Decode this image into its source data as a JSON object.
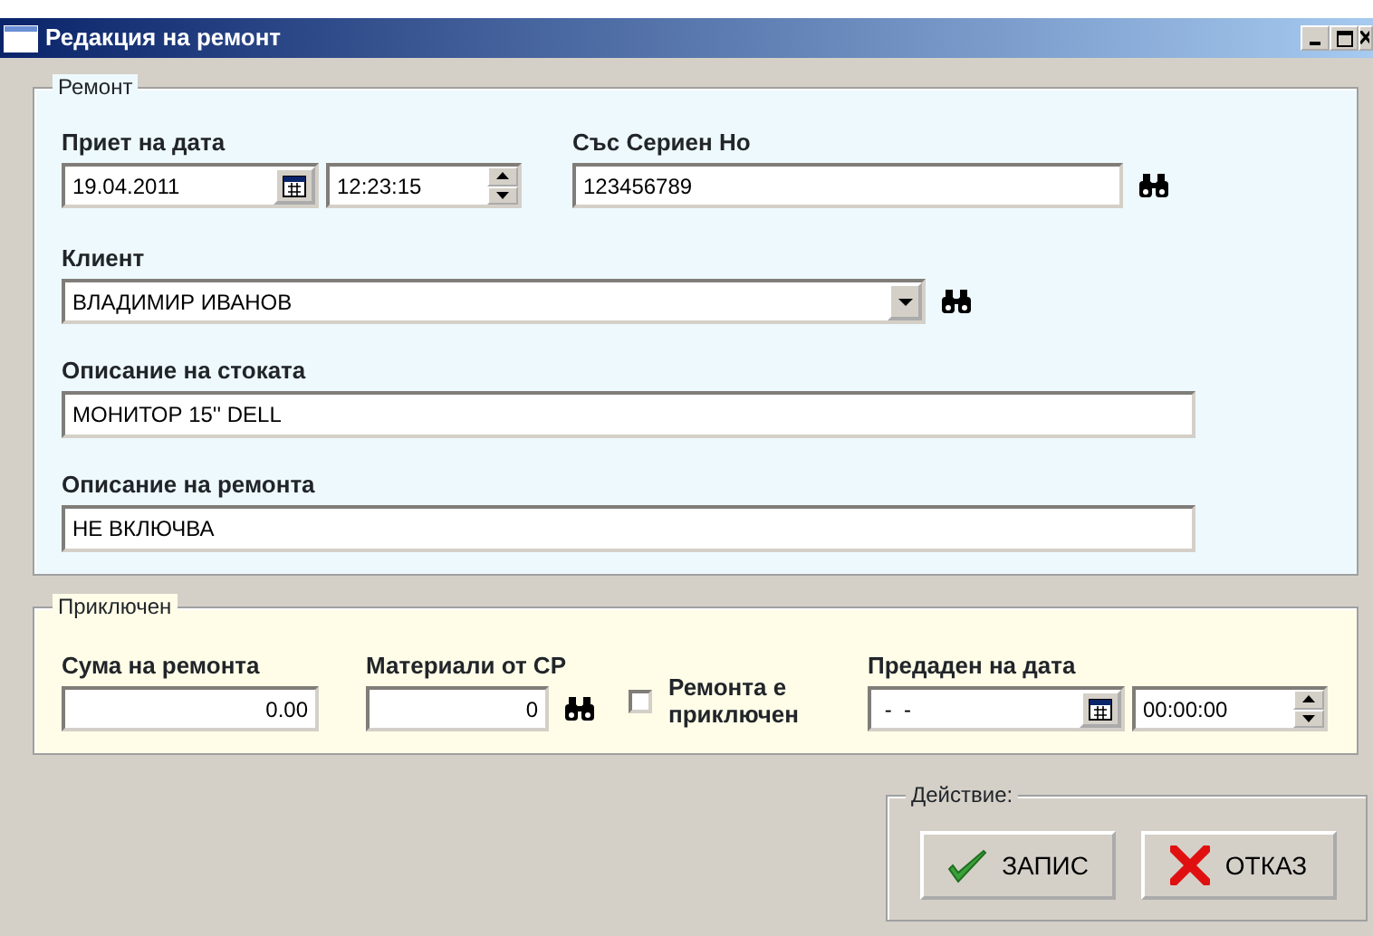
{
  "window": {
    "title": "Редакция на ремонт"
  },
  "repair": {
    "legend": "Ремонт",
    "received_date": {
      "label": "Приет на дата",
      "date": "19.04.2011",
      "time": "12:23:15"
    },
    "serial": {
      "label": "Със Сериен Но",
      "value": "123456789"
    },
    "client": {
      "label": "Клиент",
      "value": "ВЛАДИМИР ИВАНОВ"
    },
    "goods_description": {
      "label": "Описание на стоката",
      "value": "МОНИТОР 15'' DELL"
    },
    "repair_description": {
      "label": "Описание на ремонта",
      "value": "НЕ ВКЛЮЧВА"
    }
  },
  "closed": {
    "legend": "Приключен",
    "repair_sum": {
      "label": "Сума на ремонта",
      "value": "0.00"
    },
    "materials": {
      "label": "Материали от СР",
      "value": "0"
    },
    "completed": {
      "label": "Ремонта е приключен",
      "checked": false
    },
    "delivered_date": {
      "label": "Предаден на дата",
      "date": " -  -",
      "time": "00:00:00"
    }
  },
  "actions": {
    "legend": "Действие:",
    "buttons": [
      {
        "label": "ЗАПИС",
        "kind": "save"
      },
      {
        "label": "ОТКАЗ",
        "kind": "cancel"
      }
    ]
  }
}
